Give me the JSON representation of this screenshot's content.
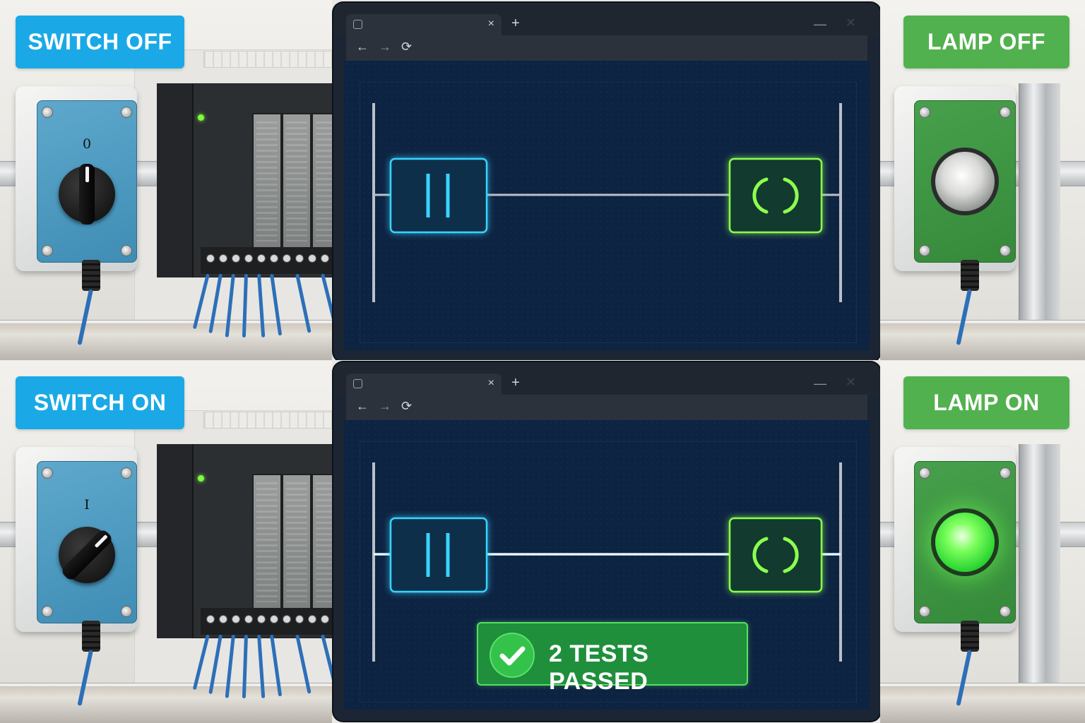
{
  "scenes": [
    {
      "switch_label": "SWITCH OFF",
      "switch_position": "0",
      "lamp_label": "LAMP OFF",
      "lamp_state": "off",
      "rung_energized": false,
      "test_result": null
    },
    {
      "switch_label": "SWITCH ON",
      "switch_position": "I",
      "lamp_label": "LAMP ON",
      "lamp_state": "on",
      "rung_energized": true,
      "test_result": "2 TESTS PASSED"
    }
  ],
  "editor": {
    "tab_close": "×",
    "new_tab": "+",
    "minimize": "—",
    "close": "✕",
    "nav_back": "←",
    "nav_forward": "→",
    "nav_reload": "⟳",
    "contact_symbol": "| |",
    "coil_symbol": "( )"
  },
  "colors": {
    "switch_tag": "#1aa9e6",
    "lamp_tag": "#52b14f",
    "contact": "#39d3ff",
    "coil": "#8cff4f",
    "rung_off": "#b9c0c7",
    "rung_on": "#e8f4ff",
    "test_passed": "#1f8f3c"
  }
}
